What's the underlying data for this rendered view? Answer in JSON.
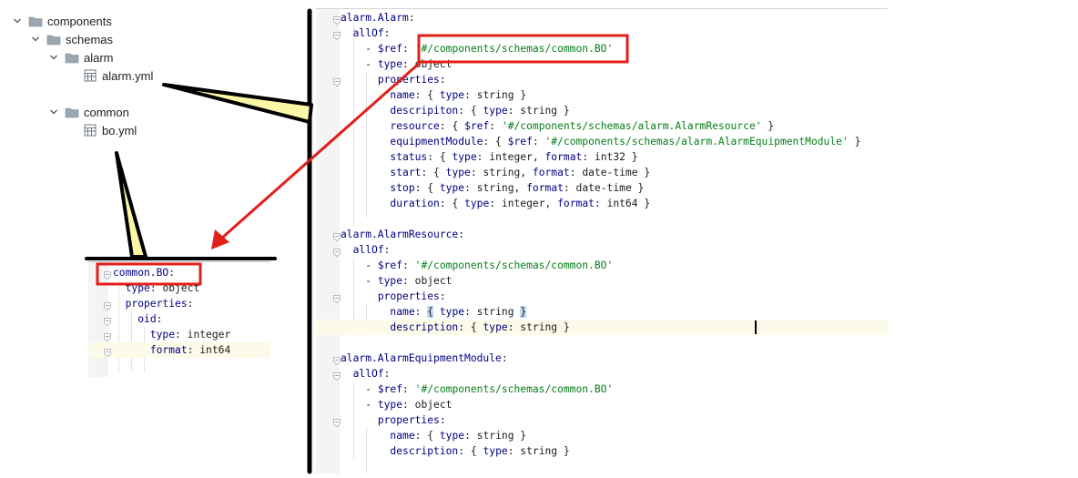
{
  "tree": {
    "items": [
      {
        "label": "components",
        "depth": 0,
        "kind": "folder",
        "expanded": true,
        "icon": "folder-icon"
      },
      {
        "label": "schemas",
        "depth": 1,
        "kind": "folder",
        "expanded": true,
        "icon": "folder-icon"
      },
      {
        "label": "alarm",
        "depth": 2,
        "kind": "folder",
        "expanded": true,
        "icon": "folder-icon"
      },
      {
        "label": "alarm.yml",
        "depth": 3,
        "kind": "file",
        "icon": "yaml-file-icon"
      },
      {
        "label": "common",
        "depth": 2,
        "kind": "folder",
        "expanded": true,
        "icon": "folder-icon"
      },
      {
        "label": "bo.yml",
        "depth": 3,
        "kind": "file",
        "icon": "yaml-file-icon"
      }
    ]
  },
  "editor": {
    "highlighted_line": 20,
    "lines": [
      [
        {
          "t": "alarm.Alarm",
          "c": "k"
        },
        {
          "t": ":",
          "c": "p"
        }
      ],
      [
        {
          "t": "  "
        },
        {
          "t": "allOf",
          "c": "k"
        },
        {
          "t": ":",
          "c": "p"
        }
      ],
      [
        {
          "t": "    - "
        },
        {
          "t": "$ref",
          "c": "k"
        },
        {
          "t": ": ",
          "c": "p"
        },
        {
          "t": "'#/components/schemas/common.BO'",
          "c": "s"
        }
      ],
      [
        {
          "t": "    - "
        },
        {
          "t": "type",
          "c": "k"
        },
        {
          "t": ": ",
          "c": "p"
        },
        {
          "t": "object",
          "c": "v"
        }
      ],
      [
        {
          "t": "      "
        },
        {
          "t": "properties",
          "c": "k"
        },
        {
          "t": ":",
          "c": "p"
        }
      ],
      [
        {
          "t": "        "
        },
        {
          "t": "name",
          "c": "k"
        },
        {
          "t": ": { ",
          "c": "p"
        },
        {
          "t": "type",
          "c": "k"
        },
        {
          "t": ": ",
          "c": "p"
        },
        {
          "t": "string",
          "c": "v"
        },
        {
          "t": " }",
          "c": "p"
        }
      ],
      [
        {
          "t": "        "
        },
        {
          "t": "descripiton",
          "c": "k"
        },
        {
          "t": ": { ",
          "c": "p"
        },
        {
          "t": "type",
          "c": "k"
        },
        {
          "t": ": ",
          "c": "p"
        },
        {
          "t": "string",
          "c": "v"
        },
        {
          "t": " }",
          "c": "p"
        }
      ],
      [
        {
          "t": "        "
        },
        {
          "t": "resource",
          "c": "k"
        },
        {
          "t": ": { ",
          "c": "p"
        },
        {
          "t": "$ref",
          "c": "k"
        },
        {
          "t": ": ",
          "c": "p"
        },
        {
          "t": "'#/components/schemas/alarm.AlarmResource'",
          "c": "s"
        },
        {
          "t": " }",
          "c": "p"
        }
      ],
      [
        {
          "t": "        "
        },
        {
          "t": "equipmentModule",
          "c": "k"
        },
        {
          "t": ": { ",
          "c": "p"
        },
        {
          "t": "$ref",
          "c": "k"
        },
        {
          "t": ": ",
          "c": "p"
        },
        {
          "t": "'#/components/schemas/alarm.AlarmEquipmentModule'",
          "c": "s"
        },
        {
          "t": " }",
          "c": "p"
        }
      ],
      [
        {
          "t": "        "
        },
        {
          "t": "status",
          "c": "k"
        },
        {
          "t": ": { ",
          "c": "p"
        },
        {
          "t": "type",
          "c": "k"
        },
        {
          "t": ": ",
          "c": "p"
        },
        {
          "t": "integer",
          "c": "v"
        },
        {
          "t": ", ",
          "c": "p"
        },
        {
          "t": "format",
          "c": "k"
        },
        {
          "t": ": ",
          "c": "p"
        },
        {
          "t": "int32",
          "c": "v"
        },
        {
          "t": " }",
          "c": "p"
        }
      ],
      [
        {
          "t": "        "
        },
        {
          "t": "start",
          "c": "k"
        },
        {
          "t": ": { ",
          "c": "p"
        },
        {
          "t": "type",
          "c": "k"
        },
        {
          "t": ": ",
          "c": "p"
        },
        {
          "t": "string",
          "c": "v"
        },
        {
          "t": ", ",
          "c": "p"
        },
        {
          "t": "format",
          "c": "k"
        },
        {
          "t": ": ",
          "c": "p"
        },
        {
          "t": "date-time",
          "c": "v"
        },
        {
          "t": " }",
          "c": "p"
        }
      ],
      [
        {
          "t": "        "
        },
        {
          "t": "stop",
          "c": "k"
        },
        {
          "t": ": { ",
          "c": "p"
        },
        {
          "t": "type",
          "c": "k"
        },
        {
          "t": ": ",
          "c": "p"
        },
        {
          "t": "string",
          "c": "v"
        },
        {
          "t": ", ",
          "c": "p"
        },
        {
          "t": "format",
          "c": "k"
        },
        {
          "t": ": ",
          "c": "p"
        },
        {
          "t": "date-time",
          "c": "v"
        },
        {
          "t": " }",
          "c": "p"
        }
      ],
      [
        {
          "t": "        "
        },
        {
          "t": "duration",
          "c": "k"
        },
        {
          "t": ": { ",
          "c": "p"
        },
        {
          "t": "type",
          "c": "k"
        },
        {
          "t": ": ",
          "c": "p"
        },
        {
          "t": "integer",
          "c": "v"
        },
        {
          "t": ", ",
          "c": "p"
        },
        {
          "t": "format",
          "c": "k"
        },
        {
          "t": ": ",
          "c": "p"
        },
        {
          "t": "int64",
          "c": "v"
        },
        {
          "t": " }",
          "c": "p"
        }
      ],
      [],
      [
        {
          "t": "alarm.AlarmResource",
          "c": "k"
        },
        {
          "t": ":",
          "c": "p"
        }
      ],
      [
        {
          "t": "  "
        },
        {
          "t": "allOf",
          "c": "k"
        },
        {
          "t": ":",
          "c": "p"
        }
      ],
      [
        {
          "t": "    - "
        },
        {
          "t": "$ref",
          "c": "k"
        },
        {
          "t": ": ",
          "c": "p"
        },
        {
          "t": "'#/components/schemas/common.BO'",
          "c": "s"
        }
      ],
      [
        {
          "t": "    - "
        },
        {
          "t": "type",
          "c": "k"
        },
        {
          "t": ": ",
          "c": "p"
        },
        {
          "t": "object",
          "c": "v"
        }
      ],
      [
        {
          "t": "      "
        },
        {
          "t": "properties",
          "c": "k"
        },
        {
          "t": ":",
          "c": "p"
        }
      ],
      [
        {
          "t": "        "
        },
        {
          "t": "name",
          "c": "k"
        },
        {
          "t": ": ",
          "c": "p"
        },
        {
          "t": "{",
          "c": "b"
        },
        {
          "t": " ",
          "c": "p"
        },
        {
          "t": "type",
          "c": "k"
        },
        {
          "t": ": ",
          "c": "p"
        },
        {
          "t": "string",
          "c": "v"
        },
        {
          "t": " ",
          "c": "p"
        },
        {
          "t": "}",
          "c": "b"
        }
      ],
      [
        {
          "t": "        "
        },
        {
          "t": "description",
          "c": "k"
        },
        {
          "t": ": { ",
          "c": "p"
        },
        {
          "t": "type",
          "c": "k"
        },
        {
          "t": ": ",
          "c": "p"
        },
        {
          "t": "string",
          "c": "v"
        },
        {
          "t": " }",
          "c": "p"
        }
      ],
      [],
      [
        {
          "t": "alarm.AlarmEquipmentModule",
          "c": "k"
        },
        {
          "t": ":",
          "c": "p"
        }
      ],
      [
        {
          "t": "  "
        },
        {
          "t": "allOf",
          "c": "k"
        },
        {
          "t": ":",
          "c": "p"
        }
      ],
      [
        {
          "t": "    - "
        },
        {
          "t": "$ref",
          "c": "k"
        },
        {
          "t": ": ",
          "c": "p"
        },
        {
          "t": "'#/components/schemas/common.BO'",
          "c": "s"
        }
      ],
      [
        {
          "t": "    - "
        },
        {
          "t": "type",
          "c": "k"
        },
        {
          "t": ": ",
          "c": "p"
        },
        {
          "t": "object",
          "c": "v"
        }
      ],
      [
        {
          "t": "      "
        },
        {
          "t": "properties",
          "c": "k"
        },
        {
          "t": ":",
          "c": "p"
        }
      ],
      [
        {
          "t": "        "
        },
        {
          "t": "name",
          "c": "k"
        },
        {
          "t": ": { ",
          "c": "p"
        },
        {
          "t": "type",
          "c": "k"
        },
        {
          "t": ": ",
          "c": "p"
        },
        {
          "t": "string",
          "c": "v"
        },
        {
          "t": " }",
          "c": "p"
        }
      ],
      [
        {
          "t": "        "
        },
        {
          "t": "description",
          "c": "k"
        },
        {
          "t": ": { ",
          "c": "p"
        },
        {
          "t": "type",
          "c": "k"
        },
        {
          "t": ": ",
          "c": "p"
        },
        {
          "t": "string",
          "c": "v"
        },
        {
          "t": " }",
          "c": "p"
        }
      ]
    ]
  },
  "mini_editor": {
    "highlighted_line": 5,
    "lines": [
      [
        {
          "t": "common.BO",
          "c": "k"
        },
        {
          "t": ":",
          "c": "p"
        }
      ],
      [
        {
          "t": "  "
        },
        {
          "t": "type",
          "c": "k"
        },
        {
          "t": ": ",
          "c": "p"
        },
        {
          "t": "object",
          "c": "v"
        }
      ],
      [
        {
          "t": "  "
        },
        {
          "t": "properties",
          "c": "k"
        },
        {
          "t": ":",
          "c": "p"
        }
      ],
      [
        {
          "t": "    "
        },
        {
          "t": "oid",
          "c": "k"
        },
        {
          "t": ":",
          "c": "p"
        }
      ],
      [
        {
          "t": "      "
        },
        {
          "t": "type",
          "c": "k"
        },
        {
          "t": ": ",
          "c": "p"
        },
        {
          "t": "integer",
          "c": "v"
        }
      ],
      [
        {
          "t": "      "
        },
        {
          "t": "format",
          "c": "k"
        },
        {
          "t": ": ",
          "c": "p"
        },
        {
          "t": "int64",
          "c": "v"
        }
      ]
    ]
  },
  "annotations": {
    "box_color": "#e0201b",
    "arrow_color": "#e0201b",
    "callout_fill": "#fbf7a6",
    "callout_stroke": "#000000"
  }
}
